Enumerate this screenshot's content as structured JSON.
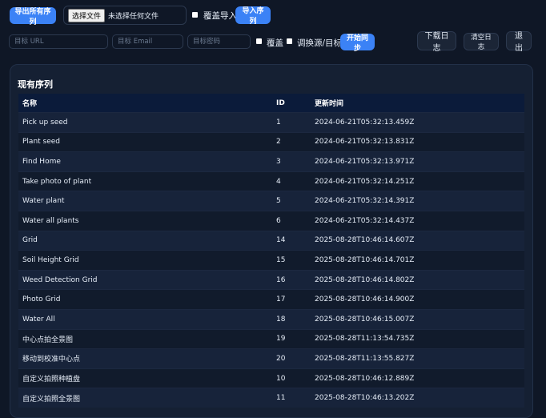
{
  "toolbar": {
    "export_all_label": "导出所有序列",
    "file_choose_label": "选择文件",
    "file_none_label": "未选择任何文件",
    "overwrite_import_label": "覆盖导入",
    "import_label": "导入序列"
  },
  "sync": {
    "url_placeholder": "目标 URL",
    "email_placeholder": "目标 Email",
    "password_placeholder": "目标密码",
    "overwrite_label": "覆盖",
    "swap_label": "调换源/目标",
    "start_sync_label": "开始同步",
    "download_log_label": "下载日志",
    "clear_log_label": "清空日志",
    "logout_label": "退出"
  },
  "panel": {
    "title": "现有序列",
    "headers": {
      "name": "名称",
      "id": "ID",
      "updated": "更新时间"
    },
    "rows": [
      {
        "name": "Pick up seed",
        "id": "1",
        "updated": "2024-06-21T05:32:13.459Z"
      },
      {
        "name": "Plant seed",
        "id": "2",
        "updated": "2024-06-21T05:32:13.831Z"
      },
      {
        "name": "Find Home",
        "id": "3",
        "updated": "2024-06-21T05:32:13.971Z"
      },
      {
        "name": "Take photo of plant",
        "id": "4",
        "updated": "2024-06-21T05:32:14.251Z"
      },
      {
        "name": "Water plant",
        "id": "5",
        "updated": "2024-06-21T05:32:14.391Z"
      },
      {
        "name": "Water all plants",
        "id": "6",
        "updated": "2024-06-21T05:32:14.437Z"
      },
      {
        "name": "Grid",
        "id": "14",
        "updated": "2025-08-28T10:46:14.607Z"
      },
      {
        "name": "Soil Height Grid",
        "id": "15",
        "updated": "2025-08-28T10:46:14.701Z"
      },
      {
        "name": "Weed Detection Grid",
        "id": "16",
        "updated": "2025-08-28T10:46:14.802Z"
      },
      {
        "name": "Photo Grid",
        "id": "17",
        "updated": "2025-08-28T10:46:14.900Z"
      },
      {
        "name": "Water All",
        "id": "18",
        "updated": "2025-08-28T10:46:15.007Z"
      },
      {
        "name": "中心点拍全景图",
        "id": "19",
        "updated": "2025-08-28T11:13:54.735Z"
      },
      {
        "name": "移动到校准中心点",
        "id": "20",
        "updated": "2025-08-28T11:13:55.827Z"
      },
      {
        "name": "自定义拍照种植盘",
        "id": "10",
        "updated": "2025-08-28T10:46:12.889Z"
      },
      {
        "name": "自定义拍照全景图",
        "id": "11",
        "updated": "2025-08-28T10:46:13.202Z"
      }
    ]
  },
  "colors": {
    "background": "#0f1726",
    "panel": "#152033",
    "accent": "#3b82f6",
    "table_header": "#0b1b3a"
  }
}
